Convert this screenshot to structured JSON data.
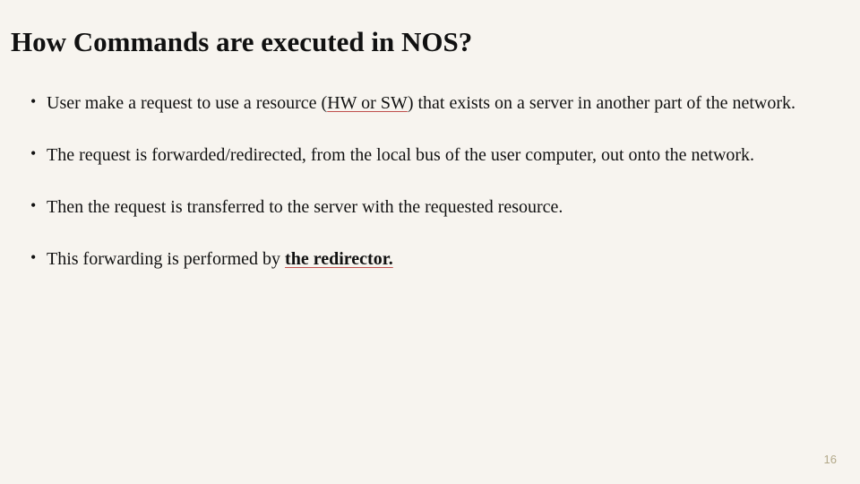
{
  "slide": {
    "title": "How Commands are executed in NOS?",
    "bullets": [
      {
        "pre": "User make a request to use a resource (",
        "mid": "HW or SW",
        "post": ") that exists on a server in another part of the network."
      },
      {
        "text": "The request is forwarded/redirected, from the local bus of the user computer, out onto the network."
      },
      {
        "text": "Then the request is transferred to the server with the requested resource."
      },
      {
        "pre2": "This forwarding is performed by ",
        "emph": "the redirector."
      }
    ],
    "pageNumber": "16"
  }
}
